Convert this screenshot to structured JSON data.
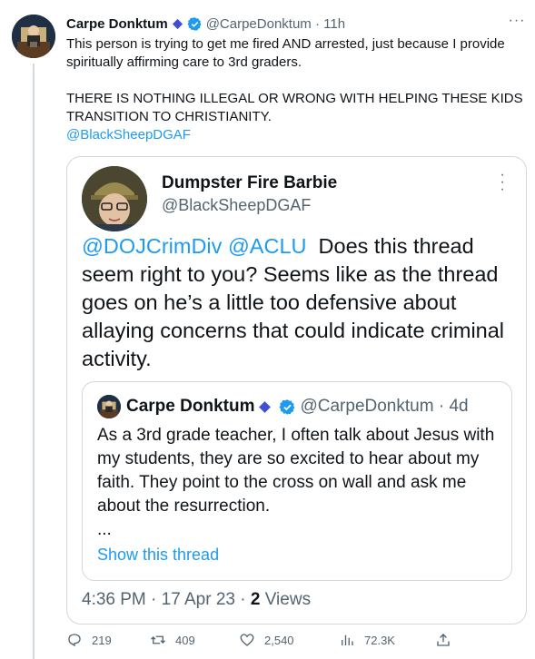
{
  "tweet": {
    "author_name": "Carpe Donktum",
    "handle": "@CarpeDonktum",
    "time": "11h",
    "more_label": "···",
    "body_line1": "This person is trying to get me fired AND arrested, just because I provide spiritually affirming care to 3rd graders.",
    "body_line2": "THERE IS NOTHING ILLEGAL OR WRONG WITH HELPING THESE KIDS TRANSITION TO CHRISTIANITY.",
    "body_mention": "@BlackSheepDGAF"
  },
  "quoted": {
    "author_name": "Dumpster Fire Barbie",
    "handle": "@BlackSheepDGAF",
    "mention1": "@DOJCrimDiv",
    "mention2": "@ACLU",
    "text": "Does this thread seem right to you? Seems like as the thread goes on he’s a little too defensive about allaying concerns that could indicate criminal activity.",
    "time": "4:36 PM · 17 Apr 23 · ",
    "views_count": "2",
    "views_label": " Views"
  },
  "inner_quote": {
    "author_name": "Carpe Donktum",
    "handle": "@CarpeDonktum",
    "time": "4d",
    "text": "As a 3rd grade teacher, I often talk about Jesus with my students, they are so excited to hear about my faith. They point to the cross on wall and ask me about the resurrection.",
    "ellipsis": "...",
    "show_thread": "Show this thread"
  },
  "actions": {
    "replies": "219",
    "retweets": "409",
    "likes": "2,540",
    "views": "72.3K"
  },
  "colors": {
    "accent": "#1d9bf0",
    "secondary_text": "#536471",
    "border": "#cfd9de",
    "affiliate_badge": "#3c4fd6"
  },
  "icons": [
    "verified-badge-icon",
    "affiliate-diamond-icon",
    "more-icon",
    "reply-icon",
    "retweet-icon",
    "like-icon",
    "views-icon",
    "share-icon"
  ]
}
